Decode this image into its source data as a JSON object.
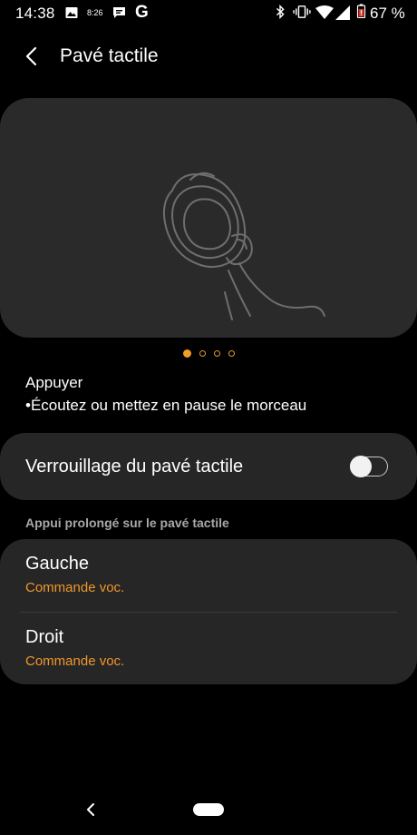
{
  "status_bar": {
    "time": "14:38",
    "small_label": "8:26",
    "g_label": "G",
    "battery": "67 %",
    "icons": [
      "image-icon",
      "message-icon",
      "g-app-icon",
      "bluetooth-icon",
      "vibrate-icon",
      "wifi-icon",
      "signal-icon",
      "battery-icon"
    ]
  },
  "header": {
    "title": "Pavé tactile",
    "back_icon": "chevron-left-icon"
  },
  "illustration": {
    "icon": "earbud-touch-icon"
  },
  "pager": {
    "count": 4,
    "active_index": 0,
    "accent": "#f39c26"
  },
  "gesture": {
    "title": "Appuyer",
    "description": "•Écoutez ou mettez en pause le morceau"
  },
  "lock": {
    "label": "Verrouillage du pavé tactile",
    "enabled": false
  },
  "long_press": {
    "section_title": "Appui prolongé sur le pavé tactile",
    "items": [
      {
        "label": "Gauche",
        "value": "Commande voc."
      },
      {
        "label": "Droit",
        "value": "Commande voc."
      }
    ]
  },
  "nav_bar": {
    "back_icon": "nav-back-icon",
    "home_icon": "nav-home-pill"
  },
  "colors": {
    "background": "#000000",
    "card": "#262626",
    "accent": "#f0962a",
    "secondary_text": "#a8a8a8"
  }
}
